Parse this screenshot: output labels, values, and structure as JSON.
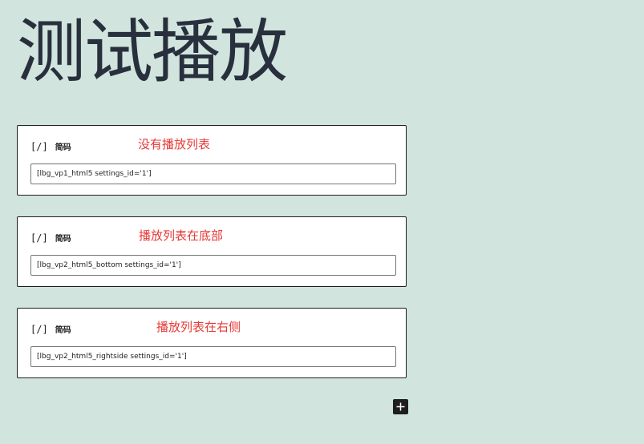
{
  "page": {
    "title": "测试播放"
  },
  "blocks": [
    {
      "icon": "[/]",
      "label": "简码",
      "annotation": "没有播放列表",
      "value": "[lbg_vp1_html5 settings_id='1']"
    },
    {
      "icon": "[/]",
      "label": "简码",
      "annotation": "播放列表在底部",
      "value": "[lbg_vp2_html5_bottom settings_id='1']"
    },
    {
      "icon": "[/]",
      "label": "简码",
      "annotation": "播放列表在右侧",
      "value": "[lbg_vp2_html5_rightside settings_id='1']"
    }
  ],
  "inserter": {
    "icon": "plus-icon"
  },
  "colors": {
    "background": "#d1e4dd",
    "title": "#28303d",
    "annotation": "#e53935",
    "block_border": "#1e1e1e"
  }
}
